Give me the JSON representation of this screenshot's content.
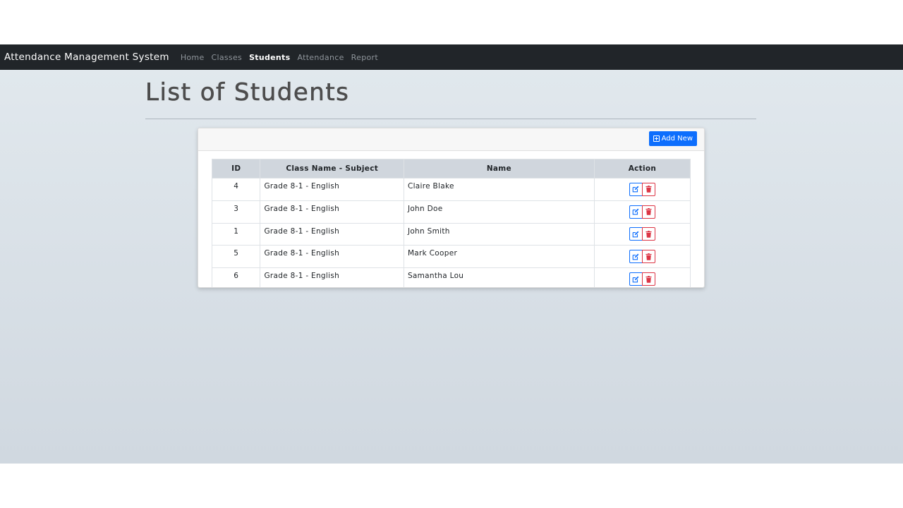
{
  "navbar": {
    "brand": "Attendance Management System",
    "links": [
      {
        "label": "Home",
        "active": false
      },
      {
        "label": "Classes",
        "active": false
      },
      {
        "label": "Students",
        "active": true
      },
      {
        "label": "Attendance",
        "active": false
      },
      {
        "label": "Report",
        "active": false
      }
    ]
  },
  "page": {
    "title": "List of Students"
  },
  "card": {
    "add_button_label": "Add New",
    "add_button_icon": "plus-square-icon"
  },
  "table": {
    "headers": {
      "id": "ID",
      "class_subject": "Class Name - Subject",
      "name": "Name",
      "action": "Action"
    },
    "rows": [
      {
        "id": "4",
        "class_subject": "Grade 8-1 - English",
        "name": "Claire Blake"
      },
      {
        "id": "3",
        "class_subject": "Grade 8-1 - English",
        "name": "John Doe"
      },
      {
        "id": "1",
        "class_subject": "Grade 8-1 - English",
        "name": "John Smith"
      },
      {
        "id": "5",
        "class_subject": "Grade 8-1 - English",
        "name": "Mark Cooper"
      },
      {
        "id": "6",
        "class_subject": "Grade 8-1 - English",
        "name": "Samantha Lou"
      }
    ],
    "row_actions": {
      "edit_icon": "edit-icon",
      "delete_icon": "trash-icon"
    }
  },
  "colors": {
    "navbar_bg": "#212529",
    "primary": "#0d6efd",
    "danger": "#dc3545",
    "header_bg": "#d0d6dd"
  }
}
